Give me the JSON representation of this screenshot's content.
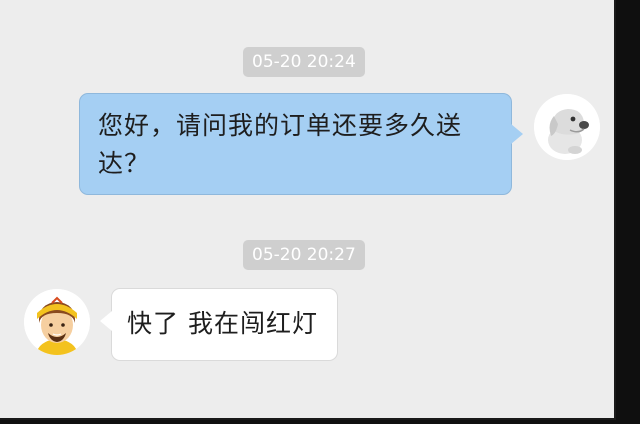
{
  "chat": {
    "messages": [
      {
        "timestamp": "05-20 20:24",
        "sender": "self",
        "avatar_icon": "dog-avatar-icon",
        "text": "您好，请问我的订单还要多久送达？",
        "bubble_color": "#a5cff3"
      },
      {
        "timestamp": "05-20 20:27",
        "sender": "courier",
        "avatar_icon": "delivery-rider-avatar-icon",
        "text": "快了 我在闯红灯",
        "bubble_color": "#ffffff"
      }
    ]
  },
  "colors": {
    "background": "#ededed",
    "timestamp_bg": "#cfcfcf",
    "outgoing_bubble": "#a5cff3",
    "incoming_bubble": "#ffffff",
    "rider_cap": "#f3c21e"
  }
}
